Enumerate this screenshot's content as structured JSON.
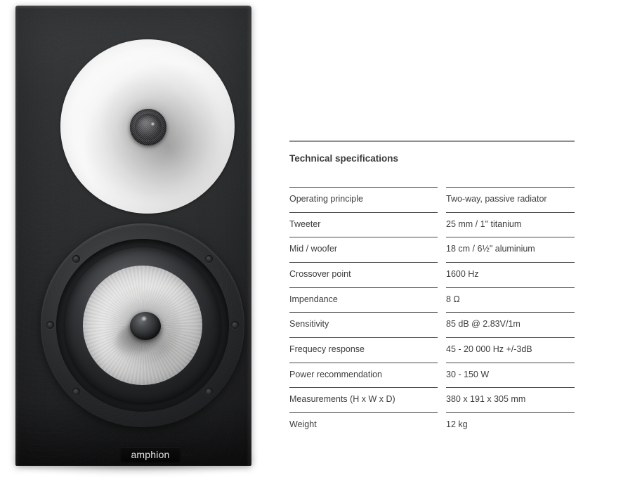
{
  "product": {
    "brand_badge": "amphion",
    "image_alt": "Black bookshelf loudspeaker with white waveguide, titanium tweeter and aluminium mid/woofer",
    "colors": {
      "cabinet": "#2b2d2e",
      "waveguide": "#fafafa",
      "cone": "#dcdcdc",
      "badge_text": "#e4e4e4"
    }
  },
  "specs": {
    "heading": "Technical specifications",
    "rows": [
      {
        "label": "Operating principle",
        "value": "Two-way, passive radiator"
      },
      {
        "label": "Tweeter",
        "value": "25 mm / 1\" titanium"
      },
      {
        "label": "Mid / woofer",
        "value": "18 cm / 6½\" aluminium"
      },
      {
        "label": "Crossover point",
        "value": "1600 Hz"
      },
      {
        "label": "Impendance",
        "value": "8 Ω"
      },
      {
        "label": "Sensitivity",
        "value": "85 dB @ 2.83V/1m"
      },
      {
        "label": "Frequecy response",
        "value": "45 - 20 000 Hz +/-3dB"
      },
      {
        "label": "Power recommendation",
        "value": "30 - 150 W"
      },
      {
        "label": "Measurements  (H x W x D)",
        "value": "380 x 191 x 305 mm"
      },
      {
        "label": "Weight",
        "value": "12 kg"
      }
    ]
  }
}
